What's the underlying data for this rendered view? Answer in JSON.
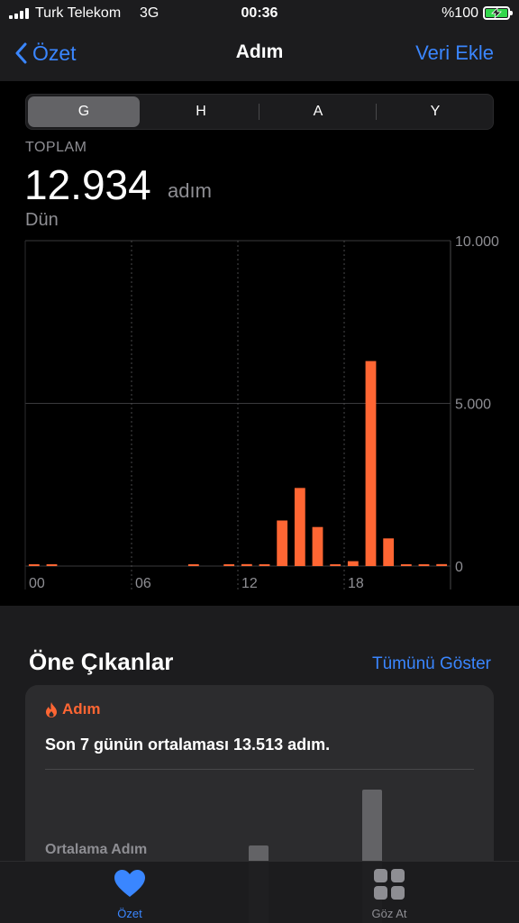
{
  "status_bar": {
    "carrier": "Turk Telekom",
    "network": "3G",
    "time": "00:36",
    "battery": "%100",
    "battery_color": "#32d74b"
  },
  "nav": {
    "back_label": "Özet",
    "title": "Adım",
    "action_label": "Veri Ekle",
    "accent_color": "#3a86ff"
  },
  "segments": {
    "items": [
      "G",
      "H",
      "A",
      "Y"
    ],
    "selected": "G"
  },
  "summary": {
    "label": "TOPLAM",
    "value": "12.934",
    "unit": "adım",
    "period": "Dün"
  },
  "chart_data": {
    "type": "bar",
    "x": [
      0,
      1,
      2,
      3,
      4,
      5,
      6,
      7,
      8,
      9,
      10,
      11,
      12,
      13,
      14,
      15,
      16,
      17,
      18,
      19,
      20,
      21,
      22,
      23
    ],
    "x_tick_labels": [
      "00",
      "06",
      "12",
      "18"
    ],
    "x_ticks": [
      0,
      6,
      12,
      18
    ],
    "values": [
      10,
      10,
      0,
      0,
      0,
      0,
      0,
      0,
      0,
      5,
      0,
      40,
      60,
      50,
      1400,
      2400,
      1200,
      50,
      150,
      6300,
      850,
      40,
      25,
      60
    ],
    "y_tick_labels": [
      "10.000",
      "5.000",
      "0"
    ],
    "ylim": [
      0,
      10000
    ],
    "bar_color": "#ff6633",
    "grid": true
  },
  "highlights": {
    "title": "Öne Çıkanlar",
    "show_all": "Tümünü Göster",
    "card": {
      "tag": "Adım",
      "text": "Son 7 günün ortalaması 13.513 adım.",
      "subtitle": "Ortalama Adım"
    }
  },
  "tab_bar": {
    "tabs": [
      {
        "label": "Özet",
        "icon": "heart-icon",
        "active": true
      },
      {
        "label": "Göz At",
        "icon": "grid-icon",
        "active": false
      }
    ]
  }
}
